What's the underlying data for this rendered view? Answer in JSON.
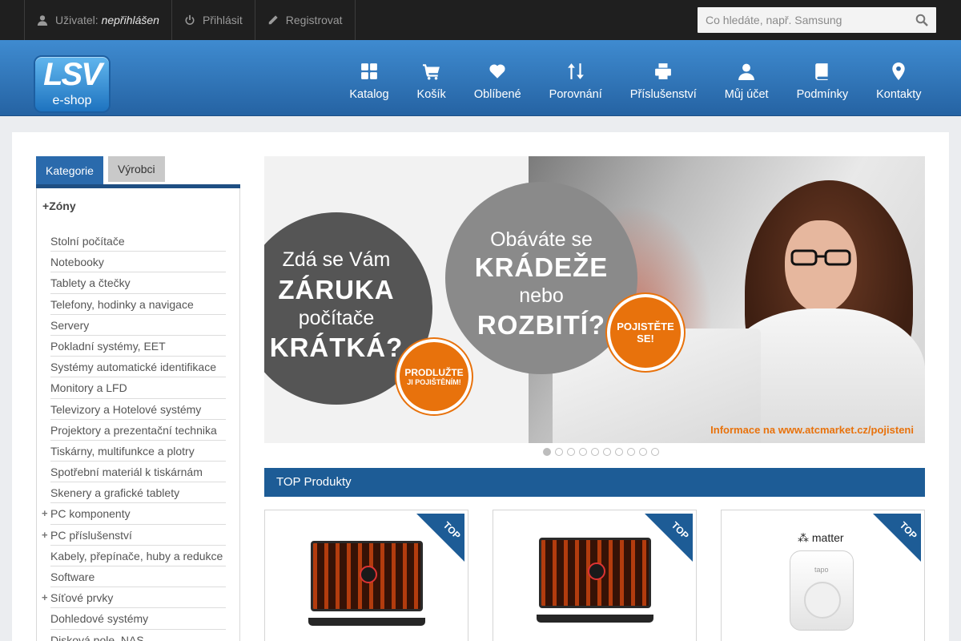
{
  "topbar": {
    "user_label": "Uživatel:",
    "user_value": "nepřihlášen",
    "login_label": "Přihlásit",
    "register_label": "Registrovat",
    "search_placeholder": "Co hledáte, např. Samsung"
  },
  "logo": {
    "line1": "LSV",
    "line2": "e-shop"
  },
  "nav": [
    {
      "label": "Katalog",
      "icon": "grid-icon"
    },
    {
      "label": "Košík",
      "icon": "cart-icon"
    },
    {
      "label": "Oblíbené",
      "icon": "heart-icon"
    },
    {
      "label": "Porovnání",
      "icon": "sort-arrows-icon"
    },
    {
      "label": "Příslušenství",
      "icon": "printer-icon"
    },
    {
      "label": "Můj účet",
      "icon": "user-icon"
    },
    {
      "label": "Podmínky",
      "icon": "book-icon"
    },
    {
      "label": "Kontakty",
      "icon": "map-pin-icon"
    }
  ],
  "sidebar": {
    "tabs": [
      "Kategorie",
      "Výrobci"
    ],
    "heading": "Zóny",
    "categories": [
      {
        "label": "Stolní počítače",
        "expandable": false
      },
      {
        "label": "Notebooky",
        "expandable": false
      },
      {
        "label": "Tablety a čtečky",
        "expandable": false
      },
      {
        "label": "Telefony, hodinky a navigace",
        "expandable": false
      },
      {
        "label": "Servery",
        "expandable": false
      },
      {
        "label": "Pokladní systémy, EET",
        "expandable": false
      },
      {
        "label": "Systémy automatické identifikace",
        "expandable": false
      },
      {
        "label": "Monitory a LFD",
        "expandable": false
      },
      {
        "label": "Televizory a Hotelové systémy",
        "expandable": false
      },
      {
        "label": "Projektory a prezentační technika",
        "expandable": false
      },
      {
        "label": "Tiskárny, multifunkce a plotry",
        "expandable": false
      },
      {
        "label": "Spotřební materiál k tiskárnám",
        "expandable": false
      },
      {
        "label": "Skenery a grafické tablety",
        "expandable": false
      },
      {
        "label": "PC komponenty",
        "expandable": true
      },
      {
        "label": "PC příslušenství",
        "expandable": true
      },
      {
        "label": "Kabely, přepínače, huby a redukce",
        "expandable": false
      },
      {
        "label": "Software",
        "expandable": false
      },
      {
        "label": "Síťové prvky",
        "expandable": true
      },
      {
        "label": "Dohledové systémy",
        "expandable": false
      },
      {
        "label": "Disková pole, NAS",
        "expandable": false
      }
    ]
  },
  "banner": {
    "c1_line1": "Zdá se Vám",
    "c1_line2": "ZÁRUKA",
    "c1_line3": "počítače",
    "c1_line4": "KRÁTKÁ?",
    "btn1_line1": "PRODLUŽTE",
    "btn1_line2": "JI POJIŠTĚNÍM!",
    "c2_line1": "Obáváte se",
    "c2_line2": "KRÁDEŽE",
    "c2_line3": "nebo",
    "c2_line4": "ROZBITÍ?",
    "btn2_line1": "POJISTĚTE",
    "btn2_line2": "SE!",
    "link": "Informace na www.atcmarket.cz/pojisteni",
    "slide_count": 10,
    "active_slide": 1
  },
  "top_products": {
    "title": "TOP Produkty",
    "badge": "TOP",
    "card3_brand": "matter",
    "card3_product": "tapo"
  },
  "colors": {
    "accent_blue": "#1d5c96",
    "header_blue": "#2e74b8",
    "orange": "#e8720c"
  }
}
